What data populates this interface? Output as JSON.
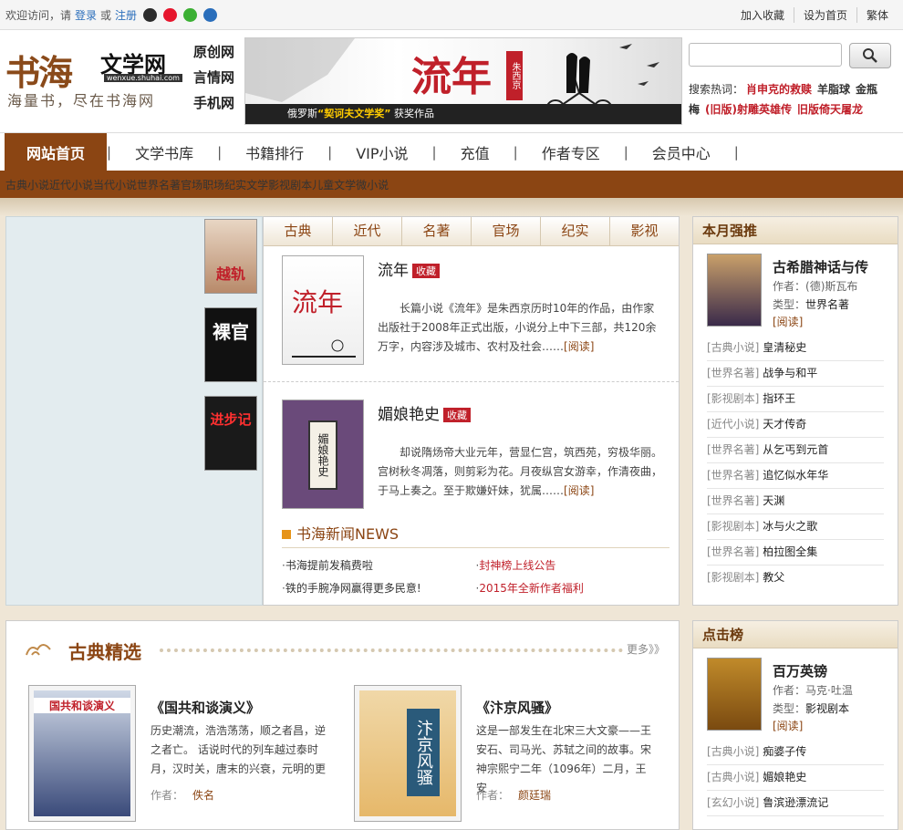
{
  "topbar": {
    "welcome": "欢迎访问，请",
    "login": "登录",
    "or": "或",
    "register": "注册",
    "social_icons": [
      "qq-icon",
      "weibo-icon",
      "wechat-icon",
      "baidu-icon"
    ],
    "links": [
      "加入收藏",
      "设为首页",
      "繁体"
    ]
  },
  "header": {
    "logo_main": "书海",
    "logo_sub": "文学网",
    "logo_url": "wenxue.shuhai.com",
    "slogan": "海量书，尽在书海网",
    "sublinks": [
      "原创网",
      "言情网",
      "手机网"
    ],
    "banner_title": "流年",
    "banner_stamp": "朱西京",
    "banner_caption_pre": "俄罗斯",
    "banner_caption_award": "“契诃夫文学奖”",
    "banner_caption_post": "获奖作品",
    "search_placeholder": "",
    "hot_label": "搜索热词：",
    "hot_words": [
      {
        "text": "肖申克的救赎",
        "red": true
      },
      {
        "text": "羊脂球",
        "red": false
      },
      {
        "text": "金瓶",
        "red": false
      },
      {
        "text": "梅",
        "red": false
      },
      {
        "text": "(旧版)射雕英雄传",
        "red": true
      },
      {
        "text": "旧版倚天屠龙",
        "red": true
      }
    ]
  },
  "nav": {
    "items": [
      "网站首页",
      "文学书库",
      "书籍排行",
      "VIP小说",
      "充值",
      "作者专区",
      "会员中心"
    ],
    "sub": [
      "古典小说",
      "近代小说",
      "当代小说",
      "世界名著",
      "官场职场",
      "纪实文学",
      "影视剧本",
      "儿童文学",
      "微小说"
    ]
  },
  "center": {
    "tabs": [
      "古典",
      "近代",
      "名著",
      "官场",
      "纪实",
      "影视"
    ],
    "books": [
      {
        "title": "流年",
        "fav": "收藏",
        "desc": "长篇小说《流年》是朱西京历时10年的作品，由作家出版社于2008年正式出版，小说分上中下三部，共120余万字，内容涉及城市、农村及社会……",
        "read": "[阅读]"
      },
      {
        "title": "媚娘艳史",
        "fav": "收藏",
        "desc": "却说隋炀帝大业元年，营显仁宫，筑西苑，穷极华丽。宫树秋冬凋落，则剪彩为花。月夜纵宫女游幸，作清夜曲，于马上奏之。至于欺嫌奸妹，犹属……",
        "read": "[阅读]"
      }
    ],
    "news_title": "书海新闻NEWS",
    "news": [
      {
        "text": "书海提前发稿费啦",
        "red": false
      },
      {
        "text": "封神榜上线公告",
        "red": true
      },
      {
        "text": "铁的手腕净网赢得更多民意!",
        "red": false
      },
      {
        "text": "2015年全新作者福利",
        "red": true
      }
    ]
  },
  "monthly": {
    "title": "本月强推",
    "feature": {
      "title": "古希腊神话与传",
      "author_label": "作者：",
      "author": "(德)斯瓦布",
      "type_label": "类型：",
      "type": "世界名著",
      "read": "[阅读]"
    },
    "list": [
      {
        "cat": "[古典小说]",
        "title": "皇清秘史"
      },
      {
        "cat": "[世界名著]",
        "title": "战争与和平"
      },
      {
        "cat": "[影视剧本]",
        "title": "指环王"
      },
      {
        "cat": "[近代小说]",
        "title": "天才传奇"
      },
      {
        "cat": "[世界名著]",
        "title": "从乞丐到元首"
      },
      {
        "cat": "[世界名著]",
        "title": "追忆似水年华"
      },
      {
        "cat": "[世界名著]",
        "title": "天渊"
      },
      {
        "cat": "[影视剧本]",
        "title": "冰与火之歌"
      },
      {
        "cat": "[世界名著]",
        "title": "柏拉图全集"
      },
      {
        "cat": "[影视剧本]",
        "title": "教父"
      }
    ]
  },
  "clicks": {
    "title": "点击榜",
    "feature": {
      "title": "百万英镑",
      "author_label": "作者：",
      "author": "马克·吐温",
      "type_label": "类型：",
      "type": "影视剧本",
      "read": "[阅读]"
    },
    "list": [
      {
        "cat": "[古典小说]",
        "title": "痴婆子传"
      },
      {
        "cat": "[古典小说]",
        "title": "媚娘艳史"
      },
      {
        "cat": "[玄幻小说]",
        "title": "鲁滨逊漂流记"
      }
    ]
  },
  "jingxuan": {
    "title": "古典精选",
    "more": "更多》》",
    "books": [
      {
        "title": "《国共和谈演义》",
        "cover": "国共和谈演义",
        "desc": "历史潮流，浩浩荡荡，顺之者昌，逆之者亡。 话说时代的列车越过泰时月，汉时关，唐末的兴衰，元明的更",
        "author_label": "作者：",
        "author": "佚名"
      },
      {
        "title": "《汴京风骚》",
        "cover": "汴京风骚",
        "desc": "这是一部发生在北宋三大文豪——王安石、司马光、苏轼之间的故事。宋神宗熙宁二年（1096年）二月，王安",
        "author_label": "作者：",
        "author": "颜廷瑞"
      }
    ]
  },
  "covers": [
    "越轨",
    "裸官",
    "进步记"
  ],
  "colors": {
    "brand": "#8b4513",
    "red": "#c0202a",
    "link": "#2a6ebb"
  }
}
